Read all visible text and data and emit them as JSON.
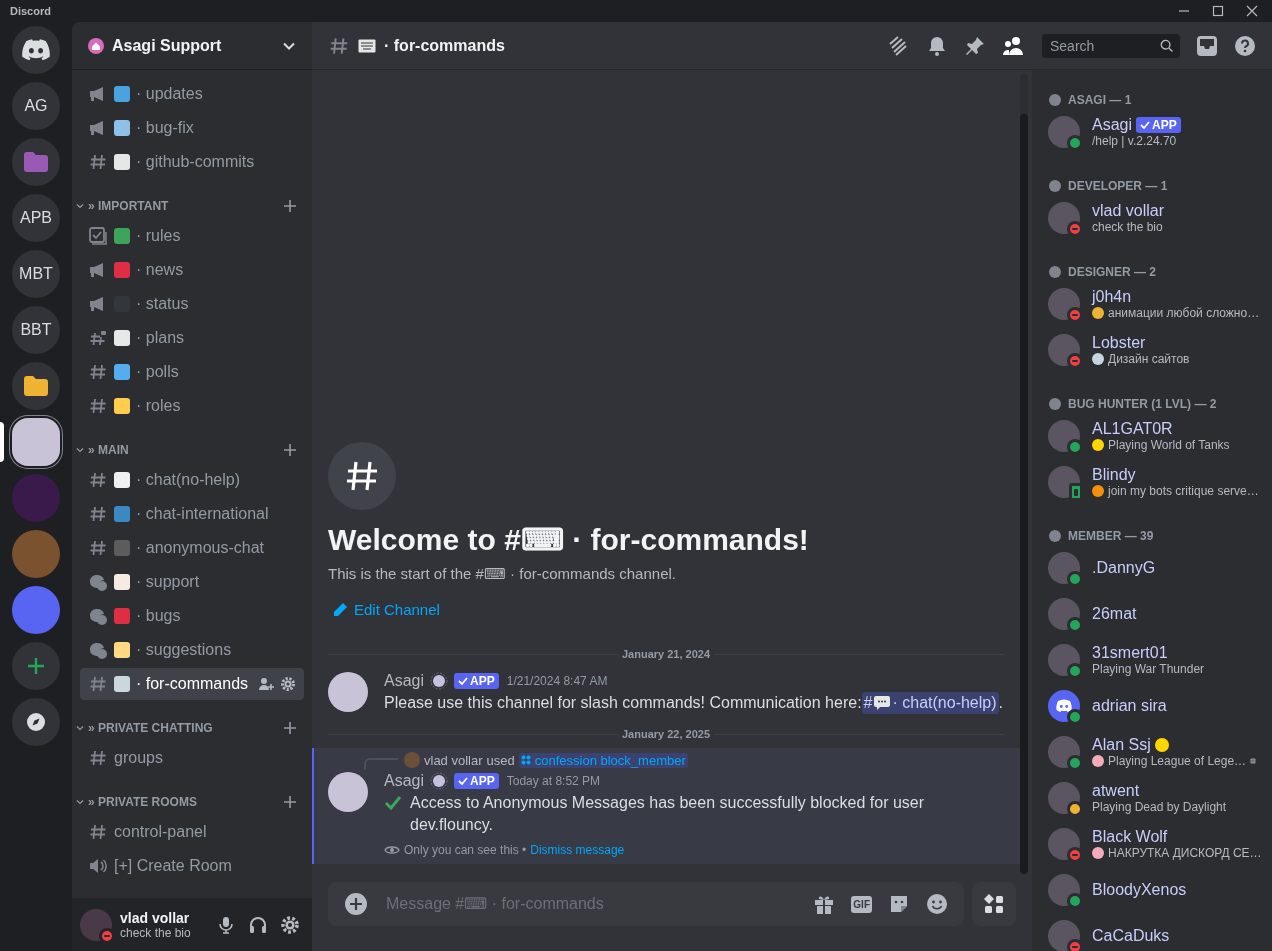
{
  "titlebar": {
    "app_name": "Discord"
  },
  "servers": [
    {
      "kind": "home",
      "selected": false
    },
    {
      "kind": "text",
      "label": "AG",
      "selected": false
    },
    {
      "kind": "folder",
      "color": "#9b59b6",
      "selected": false
    },
    {
      "kind": "text",
      "label": "APB",
      "selected": false
    },
    {
      "kind": "text",
      "label": "MBT",
      "selected": false
    },
    {
      "kind": "text",
      "label": "BBT",
      "selected": false
    },
    {
      "kind": "folder",
      "color": "#f0b232",
      "selected": false
    },
    {
      "kind": "image",
      "color": "#c9c3d8",
      "selected": true
    },
    {
      "kind": "image",
      "color": "#3a1a4a",
      "selected": false
    },
    {
      "kind": "image",
      "color": "#7a5230",
      "selected": false
    },
    {
      "kind": "image",
      "color": "#5865f2",
      "selected": false
    },
    {
      "kind": "add",
      "selected": false
    },
    {
      "kind": "explore",
      "selected": false
    }
  ],
  "server": {
    "name": "Asagi Support"
  },
  "channel_groups": [
    {
      "channels": [
        {
          "kind": "announcement",
          "color": "#4aa3df",
          "name": "· updates",
          "selected": false
        },
        {
          "kind": "announcement",
          "color": "#8fc1e8",
          "name": "· bug-fix",
          "selected": false
        },
        {
          "kind": "text",
          "color": "#e6e6e6",
          "name": "· github-commits",
          "selected": false
        }
      ]
    },
    {
      "title": "» IMPORTANT",
      "channels": [
        {
          "kind": "rules",
          "color": "#3fa35a",
          "name": "· rules",
          "selected": false
        },
        {
          "kind": "announcement",
          "color": "#dd2e44",
          "name": "· news",
          "selected": false
        },
        {
          "kind": "announcement",
          "color": "#31373d",
          "name": "· status",
          "selected": false
        },
        {
          "kind": "locked",
          "color": "#e8e8e8",
          "name": "· plans",
          "selected": false
        },
        {
          "kind": "text",
          "color": "#55acee",
          "name": "· polls",
          "selected": false
        },
        {
          "kind": "text",
          "color": "#ffcc4d",
          "name": "· roles",
          "selected": false
        }
      ]
    },
    {
      "title": "» MAIN",
      "channels": [
        {
          "kind": "text",
          "color": "#f0f0f0",
          "name": "· chat(no-help)",
          "selected": false
        },
        {
          "kind": "text",
          "color": "#3b88c3",
          "name": "· chat-international",
          "selected": false
        },
        {
          "kind": "text",
          "color": "#5c5c5c",
          "name": "· anonymous-chat",
          "selected": false
        },
        {
          "kind": "forum",
          "color": "#f5ebe0",
          "name": "· support",
          "selected": false
        },
        {
          "kind": "forum",
          "color": "#dd2e44",
          "name": "· bugs",
          "selected": false
        },
        {
          "kind": "forum",
          "color": "#ffd983",
          "name": "· suggestions",
          "selected": false
        },
        {
          "kind": "text",
          "color": "#ccd6dd",
          "name": "· for-commands",
          "selected": true
        }
      ]
    },
    {
      "title": "» PRIVATE CHATTING",
      "channels": [
        {
          "kind": "text",
          "name": "groups",
          "selected": false
        }
      ]
    },
    {
      "title": "» PRIVATE ROOMS",
      "channels": [
        {
          "kind": "text",
          "name": "control-panel",
          "selected": false
        },
        {
          "kind": "voice",
          "name": "[+] Create Room",
          "selected": false
        }
      ]
    }
  ],
  "user_panel": {
    "name": "vlad vollar",
    "status_text": "check the bio",
    "presence": {
      "kind": "dnd"
    }
  },
  "header": {
    "channel_name": "· for-commands",
    "search": {
      "placeholder": "Search"
    }
  },
  "welcome": {
    "title": "Welcome to #⌨ · for-commands!",
    "subtitle": "This is the start of the #⌨ · for-commands channel.",
    "edit": "Edit Channel"
  },
  "messages": [
    {
      "kind": "divider",
      "text": "January 21, 2024"
    },
    {
      "kind": "message",
      "ephemeral": false,
      "author": "Asagi",
      "badge": "APP",
      "time": "1/21/2024 8:47 AM",
      "text": "Please use this channel for slash commands! Communication here:",
      "mention": {
        "prefix": "#",
        "text": "· chat(no-help)"
      },
      "after": "."
    },
    {
      "kind": "divider",
      "text": "January 22, 2025"
    },
    {
      "kind": "message",
      "ephemeral": true,
      "reply": {
        "user": "vlad vollar",
        "verb": "used",
        "command": "confession block_member"
      },
      "author": "Asagi",
      "badge": "APP",
      "time": "Today at 8:52 PM",
      "check": true,
      "text": "Access to Anonymous Messages has been successfully blocked for user dev.flouncy.",
      "note": "Only you can see this •",
      "action": "Dismiss message"
    }
  ],
  "composer": {
    "placeholder": "Message #⌨ · for-commands",
    "gif": "GIF"
  },
  "member_groups": [
    {
      "title": "ASAGI — 1",
      "members": [
        {
          "name": "Asagi",
          "badge": "APP",
          "activity": {
            "text": "/help | v.2.24.70"
          },
          "presence": {
            "kind": "online"
          }
        }
      ]
    },
    {
      "title": "DEVELOPER — 1",
      "members": [
        {
          "name": "vlad vollar",
          "activity": {
            "text": "check the bio"
          },
          "presence": {
            "kind": "dnd"
          }
        }
      ]
    },
    {
      "title": "DESIGNER — 2",
      "members": [
        {
          "name": "j0h4n",
          "activity": {
            "text": "анимации любой сложно…",
            "emoji": {
              "color": "#f0b232"
            }
          },
          "presence": {
            "kind": "dnd"
          }
        },
        {
          "name": "Lobster",
          "activity": {
            "text": "Дизайн сайтов",
            "emoji": {
              "color": "#c8d4e0"
            }
          },
          "presence": {
            "kind": "dnd"
          }
        }
      ]
    },
    {
      "title": "BUG HUNTER (1 LVL) — 2",
      "members": [
        {
          "name": "AL1GAT0R",
          "activity": {
            "text": "Playing World of Tanks",
            "emoji": {
              "color": "#ffd500"
            }
          },
          "presence": {
            "kind": "online"
          }
        },
        {
          "name": "Blindy",
          "activity": {
            "text": "join my bots critique serve…",
            "emoji": {
              "color": "#f4900c"
            }
          },
          "presence": {
            "kind": "mobile"
          }
        }
      ]
    },
    {
      "title": "MEMBER — 39",
      "members": [
        {
          "name": ".DannyG",
          "presence": {
            "kind": "online"
          }
        },
        {
          "name": "26mat",
          "presence": {
            "kind": "online"
          }
        },
        {
          "name": "31smert01",
          "activity": {
            "text": "Playing War Thunder"
          },
          "presence": {
            "kind": "online"
          }
        },
        {
          "name": "adrian sira",
          "default_avatar": true,
          "presence": {
            "kind": "online"
          }
        },
        {
          "name": "Alan Ssj",
          "name_emoji": {
            "color": "#ffd700"
          },
          "activity": {
            "text": "Playing League of Lege…",
            "emoji": {
              "color": "#f4abba"
            },
            "note": true
          },
          "presence": {
            "kind": "online"
          }
        },
        {
          "name": "atwent",
          "activity": {
            "text": "Playing Dead by Daylight"
          },
          "presence": {
            "kind": "idle"
          }
        },
        {
          "name": "Black Wolf",
          "activity": {
            "text": "НАКРУТКА ДИСКОРД СЕ…",
            "emoji": {
              "color": "#f4abba"
            }
          },
          "presence": {
            "kind": "dnd"
          }
        },
        {
          "name": "BloodyXenos",
          "presence": {
            "kind": "online"
          }
        },
        {
          "name": "CaCaDuks",
          "presence": {
            "kind": "dnd"
          }
        }
      ]
    }
  ]
}
